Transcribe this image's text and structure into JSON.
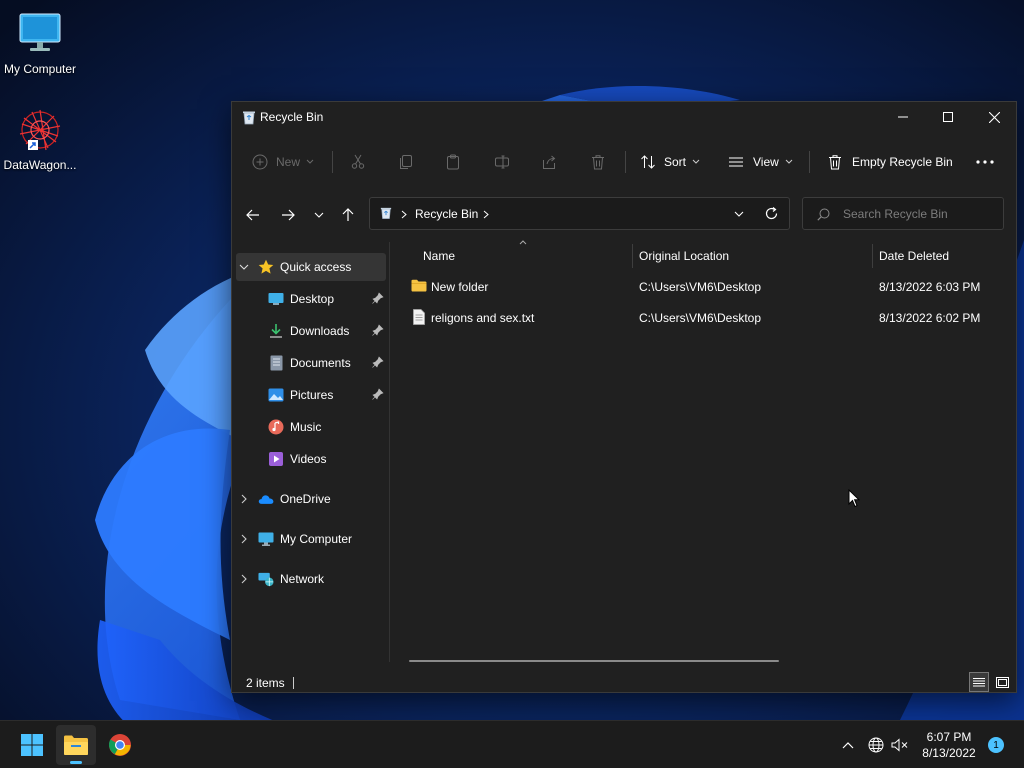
{
  "desktop": {
    "icons": [
      {
        "label": "My Computer"
      },
      {
        "label": "DataWagon..."
      }
    ]
  },
  "window": {
    "title": "Recycle Bin",
    "controls": {
      "minimize": "minimize",
      "maximize": "maximize",
      "close": "close"
    }
  },
  "toolbar": {
    "new_label": "New",
    "sort_label": "Sort",
    "view_label": "View",
    "empty_label": "Empty Recycle Bin"
  },
  "address": {
    "location": "Recycle Bin",
    "search_placeholder": "Search Recycle Bin"
  },
  "nav": {
    "quick_access": "Quick access",
    "quick_items": [
      {
        "label": "Desktop",
        "pinned": true
      },
      {
        "label": "Downloads",
        "pinned": true
      },
      {
        "label": "Documents",
        "pinned": true
      },
      {
        "label": "Pictures",
        "pinned": true
      },
      {
        "label": "Music",
        "pinned": false
      },
      {
        "label": "Videos",
        "pinned": false
      }
    ],
    "groups": [
      {
        "label": "OneDrive"
      },
      {
        "label": "My Computer"
      },
      {
        "label": "Network"
      }
    ]
  },
  "columns": {
    "name": "Name",
    "location": "Original Location",
    "date": "Date Deleted"
  },
  "files": [
    {
      "name": "New folder",
      "location": "C:\\Users\\VM6\\Desktop",
      "date": "8/13/2022 6:03 PM",
      "type": "folder"
    },
    {
      "name": "religons and sex.txt",
      "location": "C:\\Users\\VM6\\Desktop",
      "date": "8/13/2022 6:02 PM",
      "type": "text"
    }
  ],
  "status": {
    "count": "2 items"
  },
  "taskbar": {
    "time": "6:07 PM",
    "date": "8/13/2022",
    "notifications": "1"
  },
  "colors": {
    "accent": "#4cc2ff",
    "folder": "#f5c242",
    "window_bg": "#202020",
    "taskbar_bg": "#1c1c1c"
  }
}
